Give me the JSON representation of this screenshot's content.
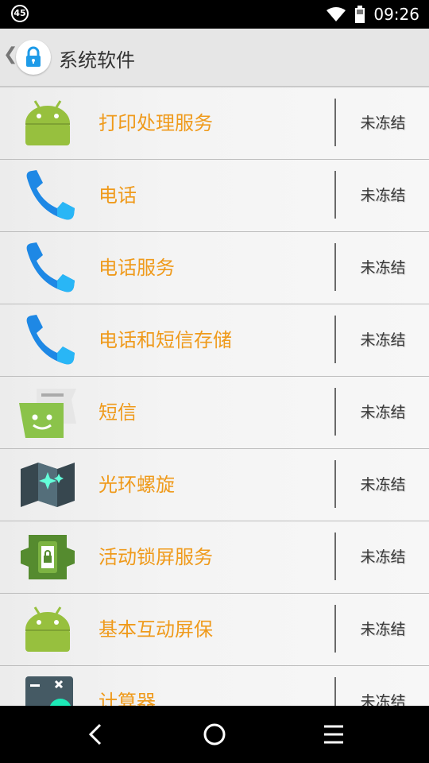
{
  "status_bar": {
    "badge": "45",
    "time": "09:26"
  },
  "action_bar": {
    "title": "系统软件",
    "back_icon": "back-chevron-icon",
    "app_icon": "lock-icon"
  },
  "apps": [
    {
      "name": "打印处理服务",
      "status": "未冻结",
      "icon": "android-icon"
    },
    {
      "name": "电话",
      "status": "未冻结",
      "icon": "phone-icon"
    },
    {
      "name": "电话服务",
      "status": "未冻结",
      "icon": "phone-icon"
    },
    {
      "name": "电话和短信存储",
      "status": "未冻结",
      "icon": "phone-icon"
    },
    {
      "name": "短信",
      "status": "未冻结",
      "icon": "sms-icon"
    },
    {
      "name": "光环螺旋",
      "status": "未冻结",
      "icon": "map-sparkle-icon"
    },
    {
      "name": "活动锁屏服务",
      "status": "未冻结",
      "icon": "puzzle-lock-icon"
    },
    {
      "name": "基本互动屏保",
      "status": "未冻结",
      "icon": "android-icon"
    },
    {
      "name": "计算器",
      "status": "未冻结",
      "icon": "calculator-icon"
    }
  ],
  "nav_bar": {
    "back": "nav-back-icon",
    "home": "nav-home-icon",
    "recents": "nav-menu-icon"
  },
  "colors": {
    "app_name": "#ef9a1b",
    "android_green": "#97c03e",
    "phone_blue": "#1e88e5",
    "status_text": "#3a3a3a"
  }
}
